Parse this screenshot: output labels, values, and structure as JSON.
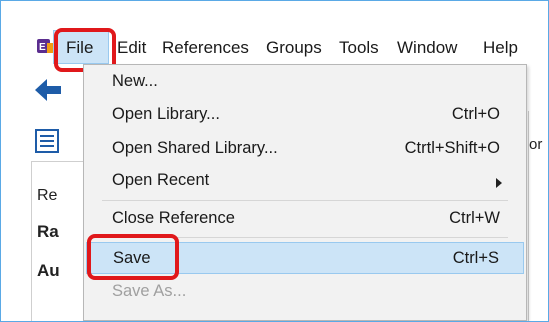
{
  "menubar": {
    "items": [
      {
        "label": "File"
      },
      {
        "label": "Edit"
      },
      {
        "label": "References"
      },
      {
        "label": "Groups"
      },
      {
        "label": "Tools"
      },
      {
        "label": "Window"
      },
      {
        "label": "Help"
      }
    ]
  },
  "background": {
    "left_labels": [
      "Re",
      "Ra",
      "Au"
    ],
    "right_fragment": "or"
  },
  "file_menu": {
    "items": [
      {
        "label": "New...",
        "shortcut": ""
      },
      {
        "label": "Open Library...",
        "shortcut": "Ctrl+O"
      },
      {
        "label": "Open Shared Library...",
        "shortcut": "Ctrtl+Shift+O"
      },
      {
        "label": "Open Recent",
        "shortcut": ""
      },
      {
        "label": "Close Reference",
        "shortcut": "Ctrl+W"
      },
      {
        "label": "Save",
        "shortcut": "Ctrl+S"
      },
      {
        "label": "Save As...",
        "shortcut": ""
      }
    ]
  },
  "colors": {
    "highlight_red": "#e0181b",
    "selection_blue": "#cce4f7",
    "frame_blue": "#5aa9e6",
    "icon_blue": "#1e5ca8"
  },
  "icons": [
    "endnote-app-icon",
    "back-arrow-icon",
    "list-view-icon",
    "submenu-arrow-icon"
  ]
}
